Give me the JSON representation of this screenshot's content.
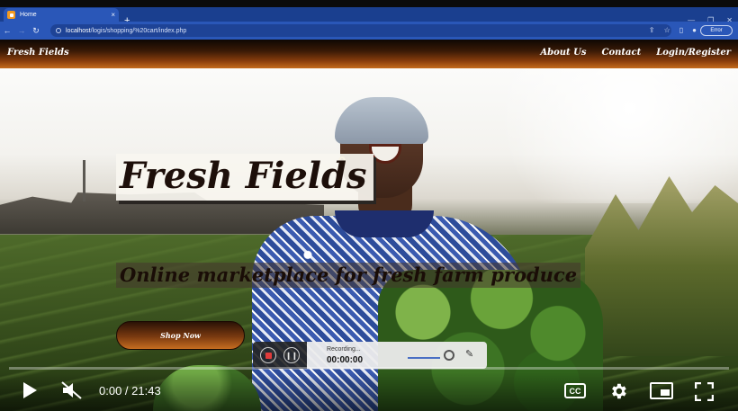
{
  "browser": {
    "tab": {
      "title": "Home",
      "close_glyph": "×"
    },
    "new_tab_glyph": "+",
    "window_controls": [
      "—",
      "❐",
      "✕"
    ],
    "url": {
      "host": "localhost",
      "path": "/logis/shopping/%20cart/index.php"
    },
    "nav": {
      "back": "←",
      "forward": "→",
      "reload": "↻"
    },
    "error_chip": "Error",
    "icons": [
      "share-icon",
      "star-icon",
      "sidebar-icon",
      "profile-icon"
    ]
  },
  "site": {
    "brand": "Fresh Fields",
    "nav_links": [
      "About Us",
      "Contact",
      "Login/Register"
    ],
    "hero": {
      "title": "Fresh Fields",
      "tagline": "Online marketplace for fresh farm produce",
      "cta": "Shop Now"
    }
  },
  "recorder": {
    "label": "Recording...",
    "time": "00:00:00"
  },
  "player": {
    "current_time": "0:00",
    "separator": " / ",
    "duration": "21:43",
    "progress_fraction": 0.0,
    "cc_label": "CC",
    "accent": "#ff0000"
  },
  "colors": {
    "tabbar": "#1a3f8f",
    "addrbar": "#2a57b8",
    "nav_gradient_end": "#c56b1c"
  }
}
